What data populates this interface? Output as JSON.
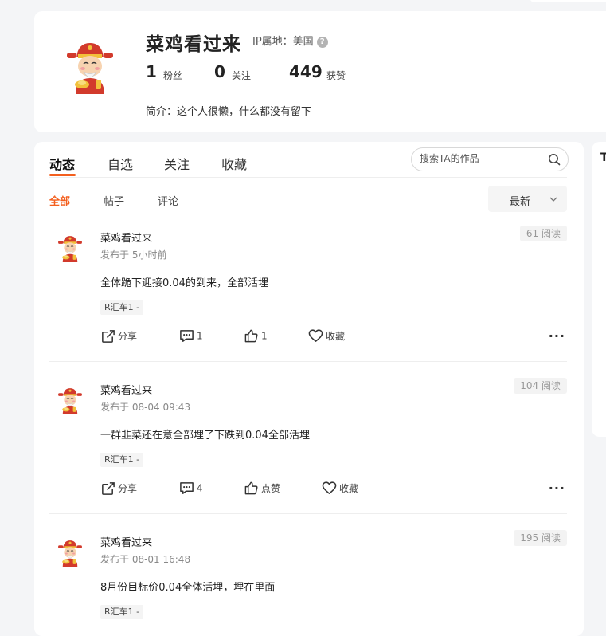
{
  "profile": {
    "username": "菜鸡看过来",
    "ip_location": "IP属地：美国",
    "help_icon": "question-circle-icon",
    "stats": [
      {
        "value": "1",
        "label": "粉丝"
      },
      {
        "value": "0",
        "label": "关注"
      },
      {
        "value": "449",
        "label": "获赞"
      }
    ],
    "bio": "简介：这个人很懒，什么都没有留下"
  },
  "tabs": [
    "动态",
    "自选",
    "关注",
    "收藏"
  ],
  "active_tab": "动态",
  "search": {
    "placeholder": "搜索TA的作品",
    "icon": "search-icon"
  },
  "subtabs": [
    "全部",
    "帖子",
    "评论"
  ],
  "active_subtab": "全部",
  "sort": {
    "label": "最新",
    "icon": "chevron-down-icon"
  },
  "side_panel": {
    "letter": "T"
  },
  "posts": [
    {
      "author": "菜鸡看过来",
      "time": "发布于 5小时前",
      "views": "61 阅读",
      "content": "全体跪下迎接0.04的到来，全部活埋",
      "tag": "R汇车1 -",
      "share": "分享",
      "comments": "1",
      "likes": "1",
      "favorite": "收藏"
    },
    {
      "author": "菜鸡看过来",
      "time": "发布于 08-04 09:43",
      "views": "104 阅读",
      "content": "一群韭菜还在意全部埋了下跌到0.04全部活埋",
      "tag": "R汇车1 -",
      "share": "分享",
      "comments": "4",
      "likes": "点赞",
      "favorite": "收藏"
    },
    {
      "author": "菜鸡看过来",
      "time": "发布于 08-01 16:48",
      "views": "195 阅读",
      "content": "8月份目标价0.04全体活埋，埋在里面",
      "tag": "R汇车1 -"
    }
  ],
  "colors": {
    "accent": "#f35f1e",
    "background": "#f4f5f7",
    "card": "#ffffff"
  }
}
